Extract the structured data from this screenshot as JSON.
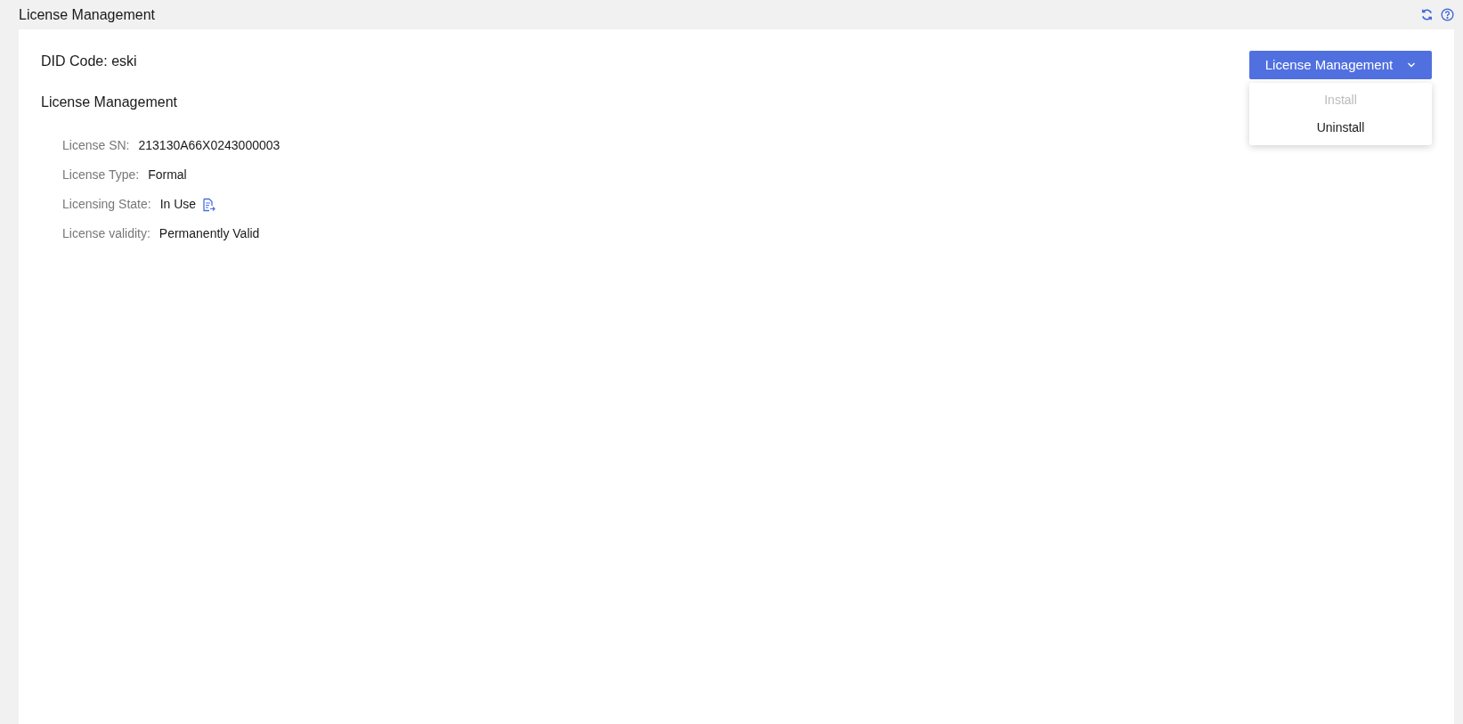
{
  "page_title": "License Management",
  "did_code": "DID Code: eski",
  "section_title": "License Management",
  "fields": [
    {
      "label": "License SN:",
      "value": "213130A66X0243000003"
    },
    {
      "label": "License Type:",
      "value": "Formal"
    },
    {
      "label": "Licensing State:",
      "value": "In Use",
      "has_icon": true
    },
    {
      "label": "License validity:",
      "value": "Permanently Valid"
    }
  ],
  "action_button": {
    "label": "License Management",
    "expanded": true
  },
  "menu_items": [
    {
      "label": "Install",
      "disabled": true
    },
    {
      "label": "Uninstall",
      "disabled": false
    }
  ]
}
